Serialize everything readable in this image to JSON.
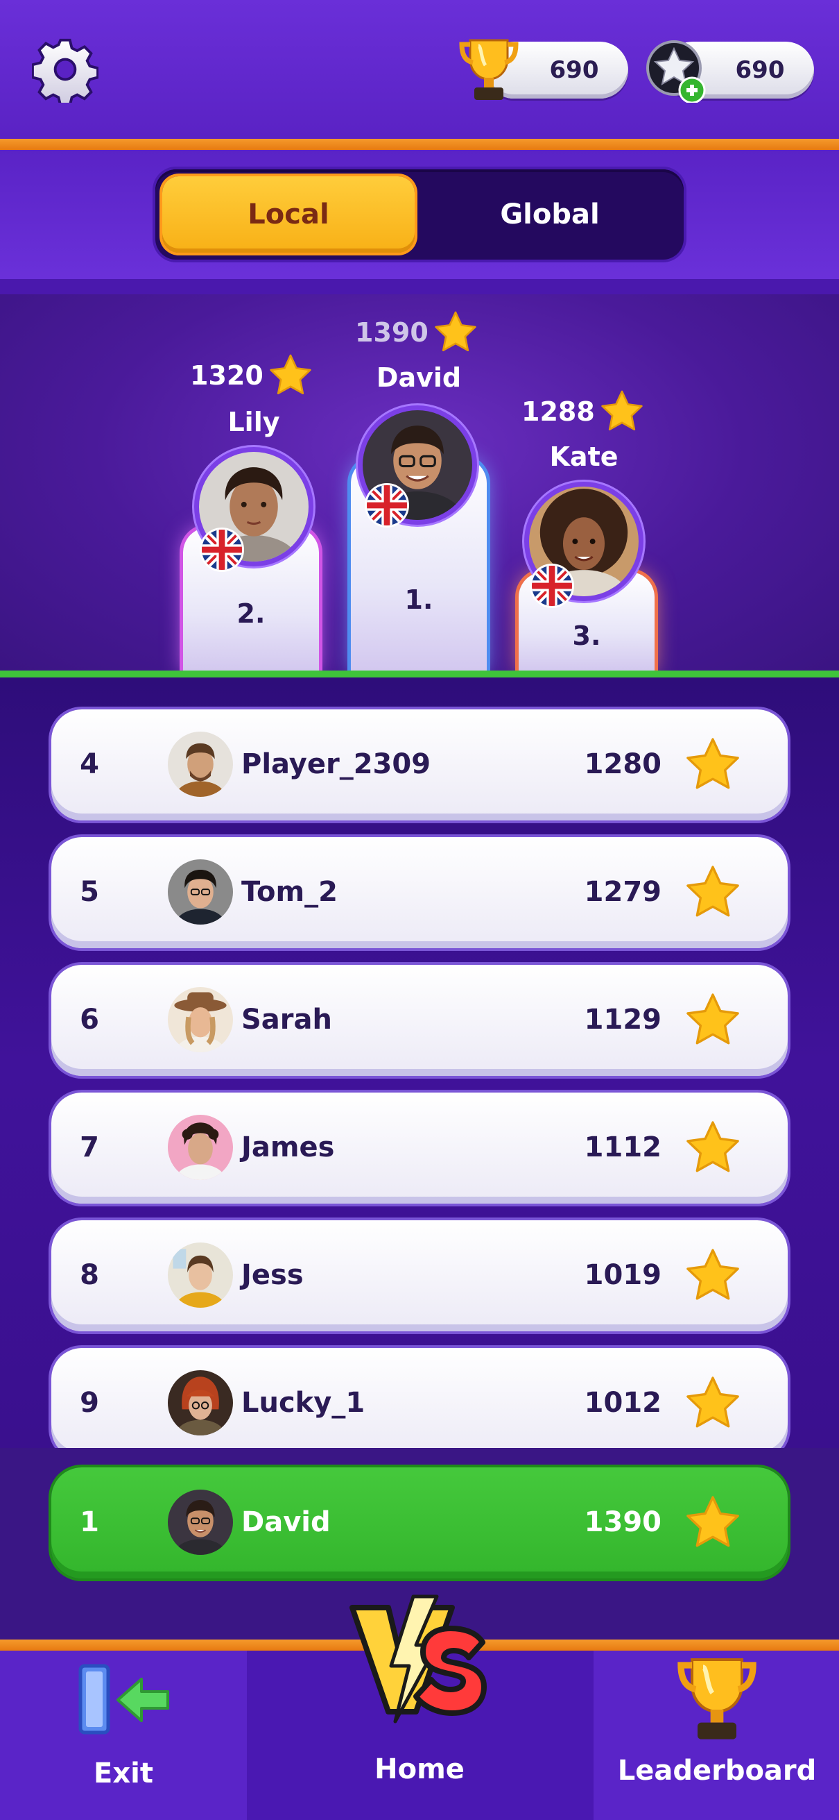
{
  "header": {
    "trophy_count": "690",
    "star_count": "690",
    "icons": [
      "gear-icon",
      "trophy-icon",
      "star-plus-icon"
    ]
  },
  "tabs": [
    {
      "label": "Local",
      "active": true
    },
    {
      "label": "Global",
      "active": false
    }
  ],
  "podium": [
    {
      "rank": "1.",
      "name": "David",
      "score": "1390",
      "flag": "uk-flag"
    },
    {
      "rank": "2.",
      "name": "Lily",
      "score": "1320",
      "flag": "uk-flag"
    },
    {
      "rank": "3.",
      "name": "Kate",
      "score": "1288",
      "flag": "uk-flag"
    }
  ],
  "leaderboard": [
    {
      "rank": "4",
      "name": "Player_2309",
      "score": "1280"
    },
    {
      "rank": "5",
      "name": "Tom_2",
      "score": "1279"
    },
    {
      "rank": "6",
      "name": "Sarah",
      "score": "1129"
    },
    {
      "rank": "7",
      "name": "James",
      "score": "1112"
    },
    {
      "rank": "8",
      "name": "Jess",
      "score": "1019"
    },
    {
      "rank": "9",
      "name": "Lucky_1",
      "score": "1012"
    }
  ],
  "current_user": {
    "rank": "1",
    "name": "David",
    "score": "1390"
  },
  "nav": {
    "exit_label": "Exit",
    "home_label": "Home",
    "leaderboard_label": "Leaderboard"
  },
  "colors": {
    "accent_orange": "#f59a2b",
    "highlight_green": "#3fc43a",
    "tab_active": "#ffcd3b",
    "background_purple": "#5a24c8"
  }
}
